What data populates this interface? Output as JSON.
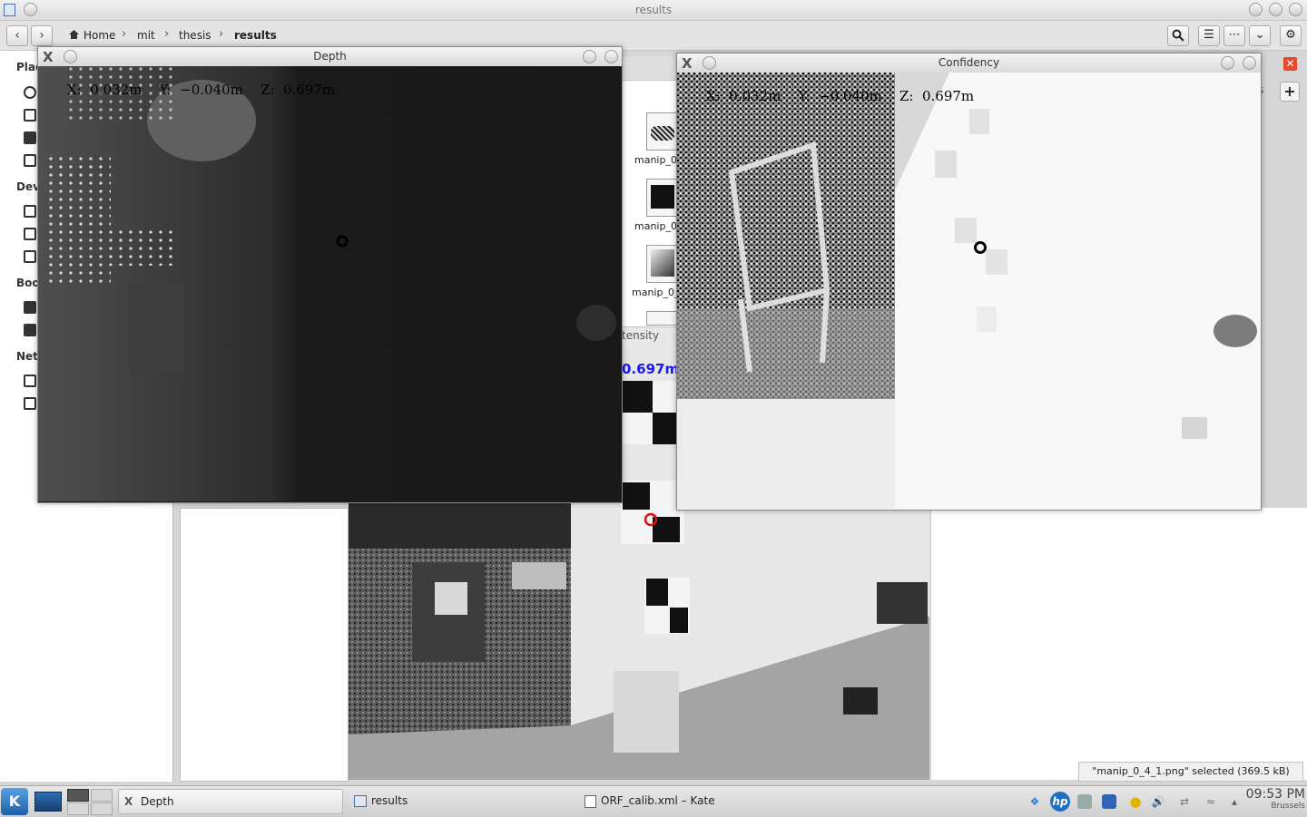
{
  "main_window": {
    "title": "results",
    "breadcrumb": [
      "Home",
      "mit",
      "thesis",
      "results"
    ],
    "places_headers": [
      "Plac",
      "Dev",
      "Boo",
      "Net"
    ],
    "thumbnails": [
      "manip_0",
      "manip_0",
      "manip_0_"
    ],
    "intensity_tab_label": "tensity",
    "intensity_readout_z": "0.697m",
    "status": "\"manip_0_4_1.png\" selected  (369.5 kB)",
    "tab_partial": "s"
  },
  "depth_window": {
    "title": "Depth",
    "readout": "X:  0.032m    Y:  −0.040m    Z:  0.697m"
  },
  "confidence_window": {
    "title": "Confidency",
    "readout": "X:  0.032m    Y:  −0.040m    Z:  0.697m"
  },
  "taskbar": {
    "tasks": [
      "Depth",
      "results",
      "ORF_calib.xml – Kate"
    ],
    "clock_time": "09:53 PM",
    "clock_location": "Brussels"
  },
  "colors": {
    "accent_blue": "#1a1af0",
    "marker_red": "#dd1111",
    "close_red": "#e84a2b"
  }
}
